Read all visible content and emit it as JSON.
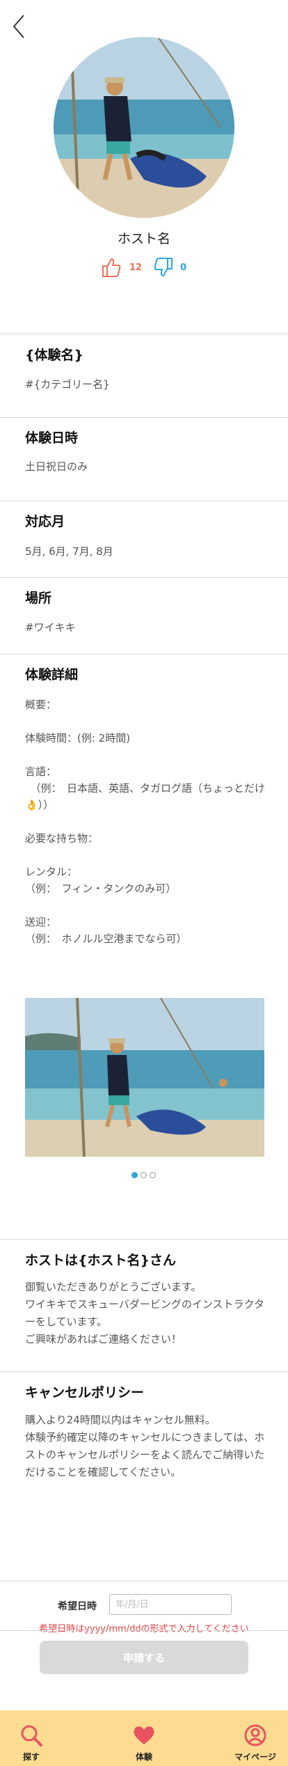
{
  "host": {
    "name": "ホスト名",
    "likes": "12",
    "dislikes": "0"
  },
  "experience": {
    "name": "{体験名}",
    "category": "#{カテゴリー名}",
    "date_title": "体験日時",
    "date_value": "土日祝日のみ",
    "months_title": "対応月",
    "months_value": "5月, 6月, 7月, 8月",
    "place_title": "場所",
    "place_value": "#ワイキキ",
    "details_title": "体験詳細",
    "details": {
      "overview": "概要：",
      "duration": "体験時間：(例: 2時間)",
      "language_label": "言語：",
      "language_example": "　（例：　日本語、英語、タガログ語（ちょっとだけ👌））",
      "belongings": "必要な持ち物：",
      "rental_label": "レンタル：",
      "rental_example": "（例：　フィン・タンクのみ可）",
      "transfer_label": "送迎：",
      "transfer_example": "（例：　ホノルル空港までなら可）"
    }
  },
  "host_intro": {
    "title": "ホストは{ホスト名}さん",
    "lines": [
      "御覧いただきありがとうございます。",
      "ワイキキでスキューバダービングのインストラクターをしています。",
      "ご興味があればご連絡ください！"
    ]
  },
  "cancel_policy": {
    "title": "キャンセルポリシー",
    "lines": [
      "購入より24時間以内はキャンセル無料。",
      "体験予約確定以降のキャンセルにつきましては、ホストのキャンセルポリシーをよく読んでご納得いただけることを確認してください。"
    ]
  },
  "booking": {
    "date_label": "希望日時",
    "date_placeholder": "年/月/日",
    "error": "希望日時はyyyy/mm/ddの形式で入力してください",
    "apply_label": "申請する"
  },
  "tabbar": {
    "items": [
      {
        "label": "探す",
        "icon": "search-icon"
      },
      {
        "label": "体験",
        "icon": "heart-icon"
      },
      {
        "label": "マイページ",
        "icon": "user-icon"
      }
    ]
  },
  "colors": {
    "accent_blue": "#2aa7de",
    "accent_red": "#e8715a",
    "tabbar_bg": "#fddc92",
    "error": "#e03c3c",
    "heart": "#e8545e"
  }
}
